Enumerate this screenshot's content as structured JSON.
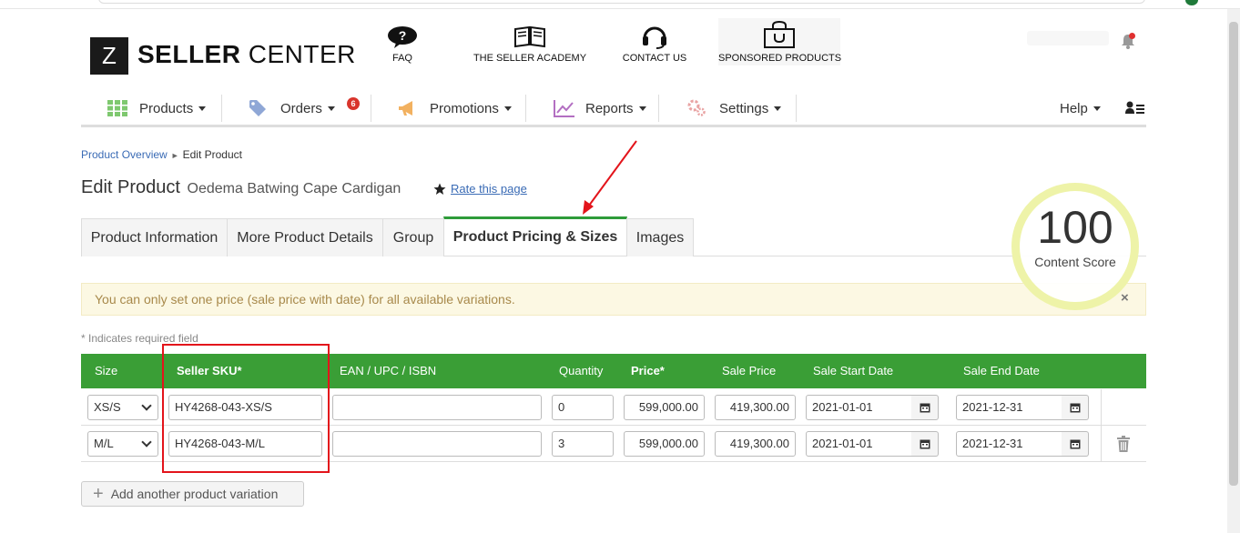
{
  "header": {
    "logo_letter": "Z",
    "logo_bold": "SELLER",
    "logo_light": "CENTER",
    "links": [
      {
        "label": "FAQ",
        "icon": "question-bubble-icon"
      },
      {
        "label": "THE SELLER ACADEMY",
        "icon": "book-icon"
      },
      {
        "label": "CONTACT US",
        "icon": "headset-icon"
      },
      {
        "label": "SPONSORED PRODUCTS",
        "icon": "shopping-bag-icon"
      }
    ]
  },
  "nav": {
    "items": [
      {
        "label": "Products",
        "icon": "grid-icon"
      },
      {
        "label": "Orders",
        "icon": "tag-icon",
        "badge": "6"
      },
      {
        "label": "Promotions",
        "icon": "megaphone-icon"
      },
      {
        "label": "Reports",
        "icon": "chart-icon"
      },
      {
        "label": "Settings",
        "icon": "gear-icon"
      }
    ],
    "help": "Help"
  },
  "breadcrumb": {
    "parent": "Product Overview",
    "sep": "►",
    "current": "Edit Product"
  },
  "page": {
    "title": "Edit Product",
    "product_name": "Oedema Batwing Cape Cardigan",
    "rate_link": "Rate this page"
  },
  "tabs": [
    {
      "label": "Product Information"
    },
    {
      "label": "More Product Details"
    },
    {
      "label": "Group"
    },
    {
      "label": "Product Pricing & Sizes",
      "active": true
    },
    {
      "label": "Images"
    }
  ],
  "content_score": {
    "value": "100",
    "label": "Content Score"
  },
  "alert": {
    "text": "You can only set one price (sale price with date) for all available variations.",
    "close": "×"
  },
  "required_note": "* Indicates required field",
  "table": {
    "headers": {
      "size": "Size",
      "sku": "Seller SKU*",
      "ean": "EAN / UPC / ISBN",
      "qty": "Quantity",
      "price": "Price*",
      "sale_price": "Sale Price",
      "sale_start": "Sale Start Date",
      "sale_end": "Sale End Date"
    },
    "rows": [
      {
        "size": "XS/S",
        "sku": "HY4268-043-XS/S",
        "ean": "",
        "qty": "0",
        "price": "599,000.00",
        "sale_price": "419,300.00",
        "sale_start": "2021-01-01",
        "sale_end": "2021-12-31"
      },
      {
        "size": "M/L",
        "sku": "HY4268-043-M/L",
        "ean": "",
        "qty": "3",
        "price": "599,000.00",
        "sale_price": "419,300.00",
        "sale_start": "2021-01-01",
        "sale_end": "2021-12-31"
      }
    ]
  },
  "add_variation_label": "Add another product variation",
  "colors": {
    "brand_green": "#3a9e36",
    "active_tab_border": "#2e9c3a",
    "link_blue": "#3a6bb5",
    "annotation_red": "#e3141b",
    "score_ring": "#eef3a8",
    "alert_bg": "#fcf8e3"
  }
}
